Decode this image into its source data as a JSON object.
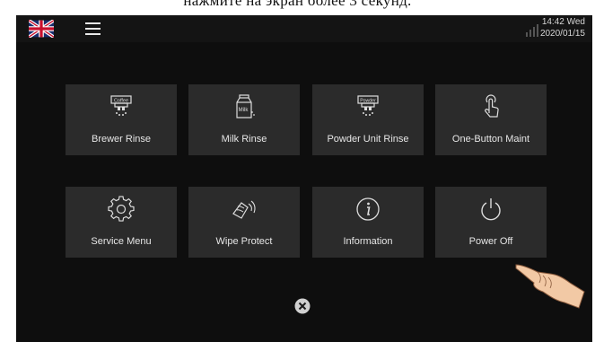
{
  "caption": "нажмите на экран более 3 секунд.",
  "status": {
    "time": "14:42 Wed",
    "date": "2020/01/15"
  },
  "tiles": [
    {
      "label": "Brewer Rinse",
      "icon": "brewer-rinse-icon",
      "icon_text": "Coffee"
    },
    {
      "label": "Milk Rinse",
      "icon": "milk-rinse-icon",
      "icon_text": "Milk"
    },
    {
      "label": "Powder Unit Rinse",
      "icon": "powder-rinse-icon",
      "icon_text": "Powder"
    },
    {
      "label": "One-Button Maint",
      "icon": "touch-icon"
    },
    {
      "label": "Service Menu",
      "icon": "gear-icon"
    },
    {
      "label": "Wipe Protect",
      "icon": "wipe-icon"
    },
    {
      "label": "Information",
      "icon": "info-icon"
    },
    {
      "label": "Power Off",
      "icon": "power-icon"
    }
  ],
  "colors": {
    "background": "#0e0e0e",
    "tile": "#2b2b2b",
    "text": "#e6e6e6"
  }
}
